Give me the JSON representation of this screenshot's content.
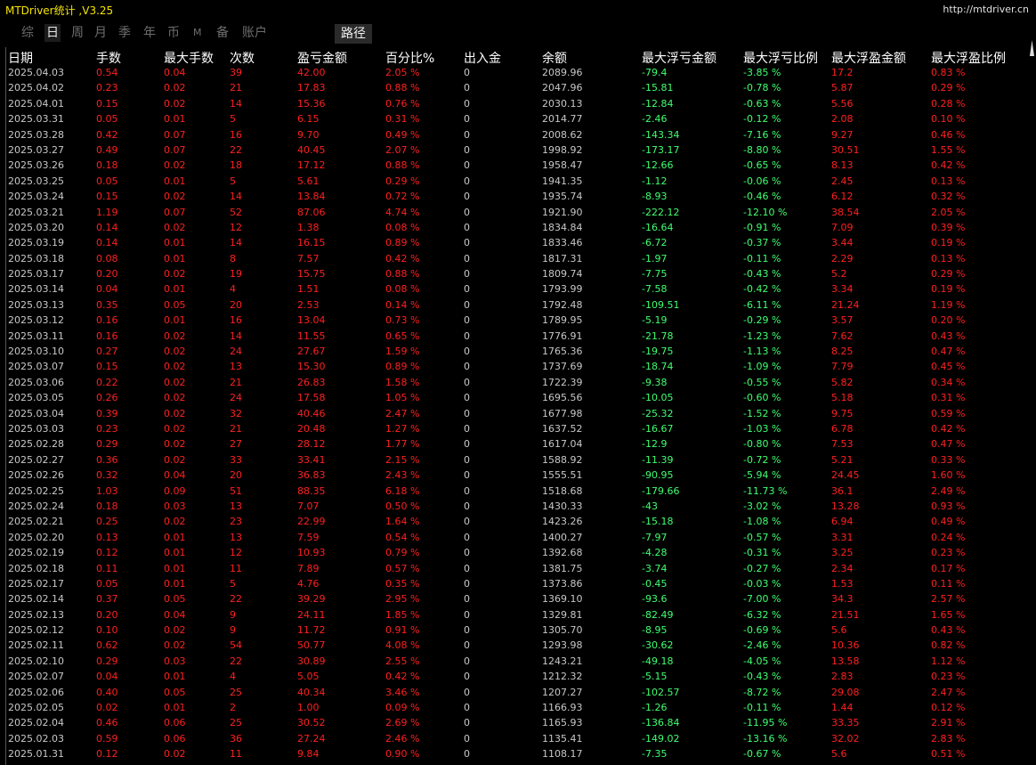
{
  "app": {
    "title": "MTDriver统计 ,V3.25",
    "url": "http://mtdriver.cn"
  },
  "tabs": [
    {
      "label": "综",
      "active": false
    },
    {
      "label": "日",
      "active": true
    },
    {
      "label": "周",
      "active": false
    },
    {
      "label": "月",
      "active": false
    },
    {
      "label": "季",
      "active": false
    },
    {
      "label": "年",
      "active": false
    },
    {
      "label": "币",
      "active": false
    },
    {
      "label": "M",
      "active": false
    },
    {
      "label": "备",
      "active": false
    },
    {
      "label": "账户",
      "active": false
    }
  ],
  "path_button": "路径",
  "colors": {
    "title": "#f5e400",
    "profit": "#ff2020",
    "loss": "#40ff70",
    "neutral": "#c8c8c8",
    "header": "#ffffff"
  },
  "table": {
    "headers": [
      "日期",
      "手数",
      "最大手数",
      "次数",
      "盈亏金额",
      "百分比%",
      "出入金",
      "余额",
      "最大浮亏金额",
      "最大浮亏比例",
      "最大浮盈金额",
      "最大浮盈比例"
    ],
    "rows": [
      [
        "2025.04.03",
        "0.54",
        "0.04",
        "39",
        "42.00",
        "2.05 %",
        "0",
        "2089.96",
        "-79.4",
        "-3.85 %",
        "17.2",
        "0.83 %"
      ],
      [
        "2025.04.02",
        "0.23",
        "0.02",
        "21",
        "17.83",
        "0.88 %",
        "0",
        "2047.96",
        "-15.81",
        "-0.78 %",
        "5.87",
        "0.29 %"
      ],
      [
        "2025.04.01",
        "0.15",
        "0.02",
        "14",
        "15.36",
        "0.76 %",
        "0",
        "2030.13",
        "-12.84",
        "-0.63 %",
        "5.56",
        "0.28 %"
      ],
      [
        "2025.03.31",
        "0.05",
        "0.01",
        "5",
        "6.15",
        "0.31 %",
        "0",
        "2014.77",
        "-2.46",
        "-0.12 %",
        "2.08",
        "0.10 %"
      ],
      [
        "2025.03.28",
        "0.42",
        "0.07",
        "16",
        "9.70",
        "0.49 %",
        "0",
        "2008.62",
        "-143.34",
        "-7.16 %",
        "9.27",
        "0.46 %"
      ],
      [
        "2025.03.27",
        "0.49",
        "0.07",
        "22",
        "40.45",
        "2.07 %",
        "0",
        "1998.92",
        "-173.17",
        "-8.80 %",
        "30.51",
        "1.55 %"
      ],
      [
        "2025.03.26",
        "0.18",
        "0.02",
        "18",
        "17.12",
        "0.88 %",
        "0",
        "1958.47",
        "-12.66",
        "-0.65 %",
        "8.13",
        "0.42 %"
      ],
      [
        "2025.03.25",
        "0.05",
        "0.01",
        "5",
        "5.61",
        "0.29 %",
        "0",
        "1941.35",
        "-1.12",
        "-0.06 %",
        "2.45",
        "0.13 %"
      ],
      [
        "2025.03.24",
        "0.15",
        "0.02",
        "14",
        "13.84",
        "0.72 %",
        "0",
        "1935.74",
        "-8.93",
        "-0.46 %",
        "6.12",
        "0.32 %"
      ],
      [
        "2025.03.21",
        "1.19",
        "0.07",
        "52",
        "87.06",
        "4.74 %",
        "0",
        "1921.90",
        "-222.12",
        "-12.10 %",
        "38.54",
        "2.05 %"
      ],
      [
        "2025.03.20",
        "0.14",
        "0.02",
        "12",
        "1.38",
        "0.08 %",
        "0",
        "1834.84",
        "-16.64",
        "-0.91 %",
        "7.09",
        "0.39 %"
      ],
      [
        "2025.03.19",
        "0.14",
        "0.01",
        "14",
        "16.15",
        "0.89 %",
        "0",
        "1833.46",
        "-6.72",
        "-0.37 %",
        "3.44",
        "0.19 %"
      ],
      [
        "2025.03.18",
        "0.08",
        "0.01",
        "8",
        "7.57",
        "0.42 %",
        "0",
        "1817.31",
        "-1.97",
        "-0.11 %",
        "2.29",
        "0.13 %"
      ],
      [
        "2025.03.17",
        "0.20",
        "0.02",
        "19",
        "15.75",
        "0.88 %",
        "0",
        "1809.74",
        "-7.75",
        "-0.43 %",
        "5.2",
        "0.29 %"
      ],
      [
        "2025.03.14",
        "0.04",
        "0.01",
        "4",
        "1.51",
        "0.08 %",
        "0",
        "1793.99",
        "-7.58",
        "-0.42 %",
        "3.34",
        "0.19 %"
      ],
      [
        "2025.03.13",
        "0.35",
        "0.05",
        "20",
        "2.53",
        "0.14 %",
        "0",
        "1792.48",
        "-109.51",
        "-6.11 %",
        "21.24",
        "1.19 %"
      ],
      [
        "2025.03.12",
        "0.16",
        "0.01",
        "16",
        "13.04",
        "0.73 %",
        "0",
        "1789.95",
        "-5.19",
        "-0.29 %",
        "3.57",
        "0.20 %"
      ],
      [
        "2025.03.11",
        "0.16",
        "0.02",
        "14",
        "11.55",
        "0.65 %",
        "0",
        "1776.91",
        "-21.78",
        "-1.23 %",
        "7.62",
        "0.43 %"
      ],
      [
        "2025.03.10",
        "0.27",
        "0.02",
        "24",
        "27.67",
        "1.59 %",
        "0",
        "1765.36",
        "-19.75",
        "-1.13 %",
        "8.25",
        "0.47 %"
      ],
      [
        "2025.03.07",
        "0.15",
        "0.02",
        "13",
        "15.30",
        "0.89 %",
        "0",
        "1737.69",
        "-18.74",
        "-1.09 %",
        "7.79",
        "0.45 %"
      ],
      [
        "2025.03.06",
        "0.22",
        "0.02",
        "21",
        "26.83",
        "1.58 %",
        "0",
        "1722.39",
        "-9.38",
        "-0.55 %",
        "5.82",
        "0.34 %"
      ],
      [
        "2025.03.05",
        "0.26",
        "0.02",
        "24",
        "17.58",
        "1.05 %",
        "0",
        "1695.56",
        "-10.05",
        "-0.60 %",
        "5.18",
        "0.31 %"
      ],
      [
        "2025.03.04",
        "0.39",
        "0.02",
        "32",
        "40.46",
        "2.47 %",
        "0",
        "1677.98",
        "-25.32",
        "-1.52 %",
        "9.75",
        "0.59 %"
      ],
      [
        "2025.03.03",
        "0.23",
        "0.02",
        "21",
        "20.48",
        "1.27 %",
        "0",
        "1637.52",
        "-16.67",
        "-1.03 %",
        "6.78",
        "0.42 %"
      ],
      [
        "2025.02.28",
        "0.29",
        "0.02",
        "27",
        "28.12",
        "1.77 %",
        "0",
        "1617.04",
        "-12.9",
        "-0.80 %",
        "7.53",
        "0.47 %"
      ],
      [
        "2025.02.27",
        "0.36",
        "0.02",
        "33",
        "33.41",
        "2.15 %",
        "0",
        "1588.92",
        "-11.39",
        "-0.72 %",
        "5.21",
        "0.33 %"
      ],
      [
        "2025.02.26",
        "0.32",
        "0.04",
        "20",
        "36.83",
        "2.43 %",
        "0",
        "1555.51",
        "-90.95",
        "-5.94 %",
        "24.45",
        "1.60 %"
      ],
      [
        "2025.02.25",
        "1.03",
        "0.09",
        "51",
        "88.35",
        "6.18 %",
        "0",
        "1518.68",
        "-179.66",
        "-11.73 %",
        "36.1",
        "2.49 %"
      ],
      [
        "2025.02.24",
        "0.18",
        "0.03",
        "13",
        "7.07",
        "0.50 %",
        "0",
        "1430.33",
        "-43",
        "-3.02 %",
        "13.28",
        "0.93 %"
      ],
      [
        "2025.02.21",
        "0.25",
        "0.02",
        "23",
        "22.99",
        "1.64 %",
        "0",
        "1423.26",
        "-15.18",
        "-1.08 %",
        "6.94",
        "0.49 %"
      ],
      [
        "2025.02.20",
        "0.13",
        "0.01",
        "13",
        "7.59",
        "0.54 %",
        "0",
        "1400.27",
        "-7.97",
        "-0.57 %",
        "3.31",
        "0.24 %"
      ],
      [
        "2025.02.19",
        "0.12",
        "0.01",
        "12",
        "10.93",
        "0.79 %",
        "0",
        "1392.68",
        "-4.28",
        "-0.31 %",
        "3.25",
        "0.23 %"
      ],
      [
        "2025.02.18",
        "0.11",
        "0.01",
        "11",
        "7.89",
        "0.57 %",
        "0",
        "1381.75",
        "-3.74",
        "-0.27 %",
        "2.34",
        "0.17 %"
      ],
      [
        "2025.02.17",
        "0.05",
        "0.01",
        "5",
        "4.76",
        "0.35 %",
        "0",
        "1373.86",
        "-0.45",
        "-0.03 %",
        "1.53",
        "0.11 %"
      ],
      [
        "2025.02.14",
        "0.37",
        "0.05",
        "22",
        "39.29",
        "2.95 %",
        "0",
        "1369.10",
        "-93.6",
        "-7.00 %",
        "34.3",
        "2.57 %"
      ],
      [
        "2025.02.13",
        "0.20",
        "0.04",
        "9",
        "24.11",
        "1.85 %",
        "0",
        "1329.81",
        "-82.49",
        "-6.32 %",
        "21.51",
        "1.65 %"
      ],
      [
        "2025.02.12",
        "0.10",
        "0.02",
        "9",
        "11.72",
        "0.91 %",
        "0",
        "1305.70",
        "-8.95",
        "-0.69 %",
        "5.6",
        "0.43 %"
      ],
      [
        "2025.02.11",
        "0.62",
        "0.02",
        "54",
        "50.77",
        "4.08 %",
        "0",
        "1293.98",
        "-30.62",
        "-2.46 %",
        "10.36",
        "0.82 %"
      ],
      [
        "2025.02.10",
        "0.29",
        "0.03",
        "22",
        "30.89",
        "2.55 %",
        "0",
        "1243.21",
        "-49.18",
        "-4.05 %",
        "13.58",
        "1.12 %"
      ],
      [
        "2025.02.07",
        "0.04",
        "0.01",
        "4",
        "5.05",
        "0.42 %",
        "0",
        "1212.32",
        "-5.15",
        "-0.43 %",
        "2.83",
        "0.23 %"
      ],
      [
        "2025.02.06",
        "0.40",
        "0.05",
        "25",
        "40.34",
        "3.46 %",
        "0",
        "1207.27",
        "-102.57",
        "-8.72 %",
        "29.08",
        "2.47 %"
      ],
      [
        "2025.02.05",
        "0.02",
        "0.01",
        "2",
        "1.00",
        "0.09 %",
        "0",
        "1166.93",
        "-1.26",
        "-0.11 %",
        "1.44",
        "0.12 %"
      ],
      [
        "2025.02.04",
        "0.46",
        "0.06",
        "25",
        "30.52",
        "2.69 %",
        "0",
        "1165.93",
        "-136.84",
        "-11.95 %",
        "33.35",
        "2.91 %"
      ],
      [
        "2025.02.03",
        "0.59",
        "0.06",
        "36",
        "27.24",
        "2.46 %",
        "0",
        "1135.41",
        "-149.02",
        "-13.16 %",
        "32.02",
        "2.83 %"
      ],
      [
        "2025.01.31",
        "0.12",
        "0.02",
        "11",
        "9.84",
        "0.90 %",
        "0",
        "1108.17",
        "-7.35",
        "-0.67 %",
        "5.6",
        "0.51 %"
      ]
    ]
  }
}
